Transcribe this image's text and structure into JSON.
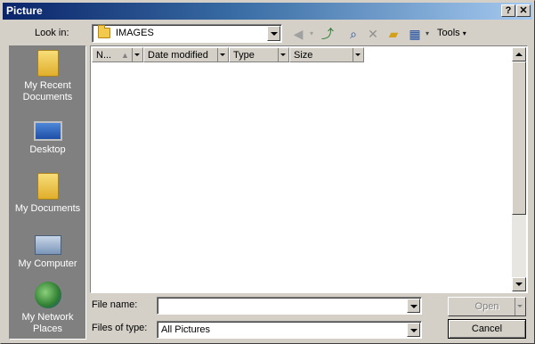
{
  "window": {
    "title": "Picture",
    "help_button": "?",
    "close_button": "✕"
  },
  "toolbar": {
    "look_in_label": "Look in:",
    "look_in_value": "IMAGES",
    "tools_label": "Tools"
  },
  "places": [
    {
      "label_line1": "My Recent",
      "label_line2": "Documents",
      "icon": "recent-documents-icon"
    },
    {
      "label_line1": "Desktop",
      "label_line2": "",
      "icon": "desktop-icon"
    },
    {
      "label_line1": "My Documents",
      "label_line2": "",
      "icon": "my-documents-icon"
    },
    {
      "label_line1": "My Computer",
      "label_line2": "",
      "icon": "my-computer-icon"
    },
    {
      "label_line1": "My Network",
      "label_line2": "Places",
      "icon": "network-places-icon"
    }
  ],
  "columns": [
    "N...",
    "Date modified",
    "Type",
    "Size"
  ],
  "fields": {
    "file_name_label": "File name:",
    "file_name_value": "",
    "files_of_type_label": "Files of type:",
    "files_of_type_value": "All Pictures"
  },
  "buttons": {
    "open": "Open",
    "cancel": "Cancel"
  }
}
